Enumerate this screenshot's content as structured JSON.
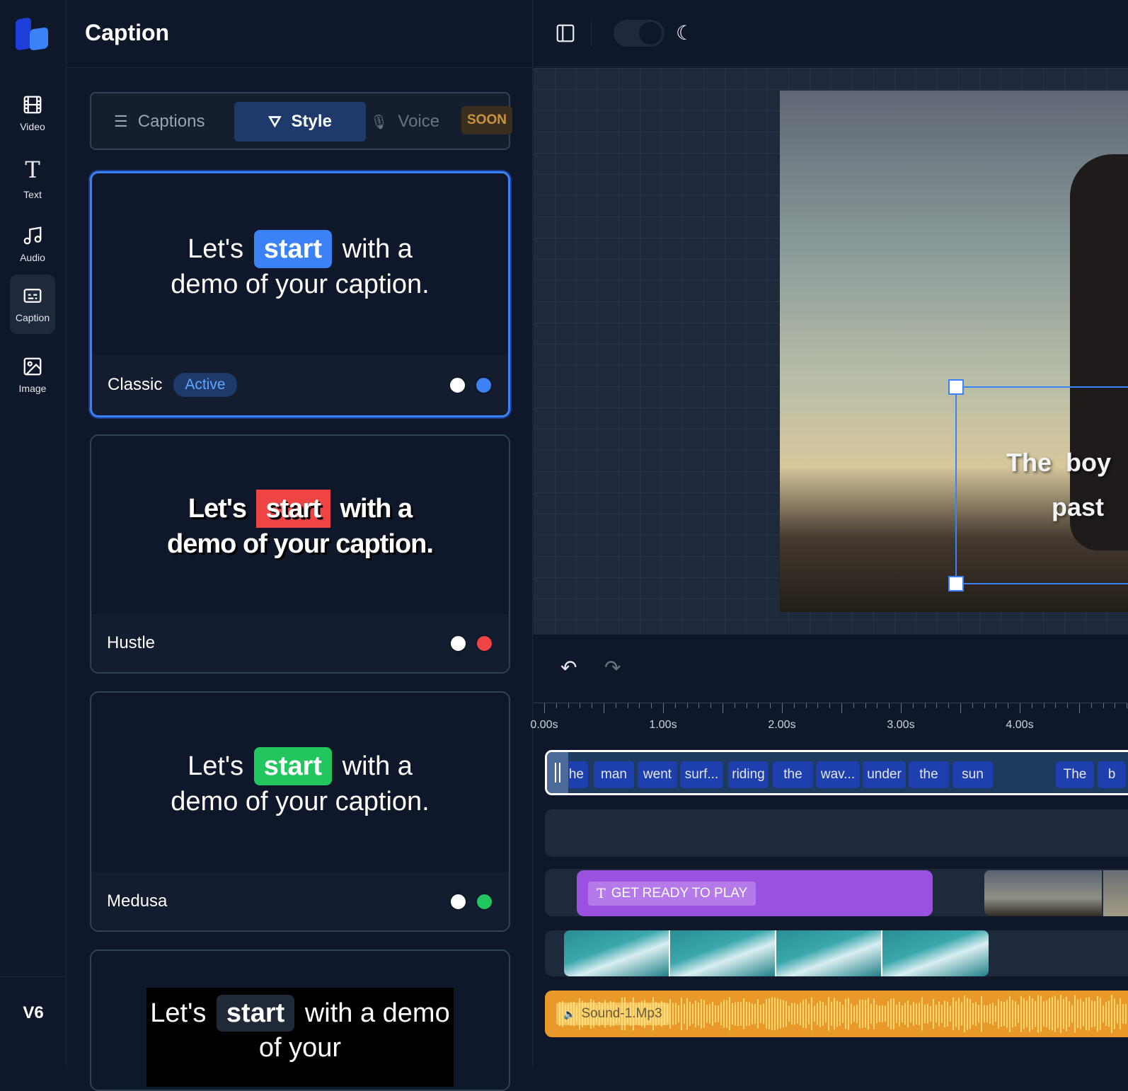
{
  "rail": {
    "items": [
      {
        "label": "Video",
        "icon": "film-icon"
      },
      {
        "label": "Text",
        "icon": "text-icon"
      },
      {
        "label": "Audio",
        "icon": "music-icon"
      },
      {
        "label": "Caption",
        "icon": "caption-icon",
        "active": true
      },
      {
        "label": "Image",
        "icon": "image-icon"
      }
    ],
    "version": "V6"
  },
  "panel": {
    "title": "Caption",
    "tabs": [
      {
        "label": "Captions"
      },
      {
        "label": "Style",
        "active": true
      },
      {
        "label": "Voice"
      }
    ],
    "soon_badge": "SOON"
  },
  "styles": [
    {
      "name": "Classic",
      "badge": "Active",
      "before": "Let's",
      "highlight": "start",
      "after": "with a demo of your caption.",
      "colors": [
        "#ffffff",
        "#3b82f6"
      ]
    },
    {
      "name": "Hustle",
      "before": "Let's",
      "highlight": "start",
      "after": "with a demo of your caption.",
      "colors": [
        "#ffffff",
        "#ef4444"
      ]
    },
    {
      "name": "Medusa",
      "before": "Let's",
      "highlight": "start",
      "after": "with a demo of your caption.",
      "colors": [
        "#ffffff",
        "#22c55e"
      ]
    },
    {
      "before": "Let's",
      "highlight": "start",
      "after": "with a demo of your"
    }
  ],
  "preview": {
    "caption_line1": "The  boy",
    "caption_line2": "past"
  },
  "timeline": {
    "ticks": [
      "0.00s",
      "1.00s",
      "2.00s",
      "3.00s",
      "4.00s"
    ],
    "words": [
      "he",
      "man",
      "went",
      "surf...",
      "riding",
      "the",
      "wav...",
      "under",
      "the",
      "sun",
      "The",
      "b"
    ],
    "text_clip": "GET READY TO PLAY",
    "audio_clip": "Sound-1.Mp3"
  },
  "colors": {
    "accent": "#3b82f6",
    "text_clip": "#9b51e0",
    "audio": "#e8992a"
  }
}
